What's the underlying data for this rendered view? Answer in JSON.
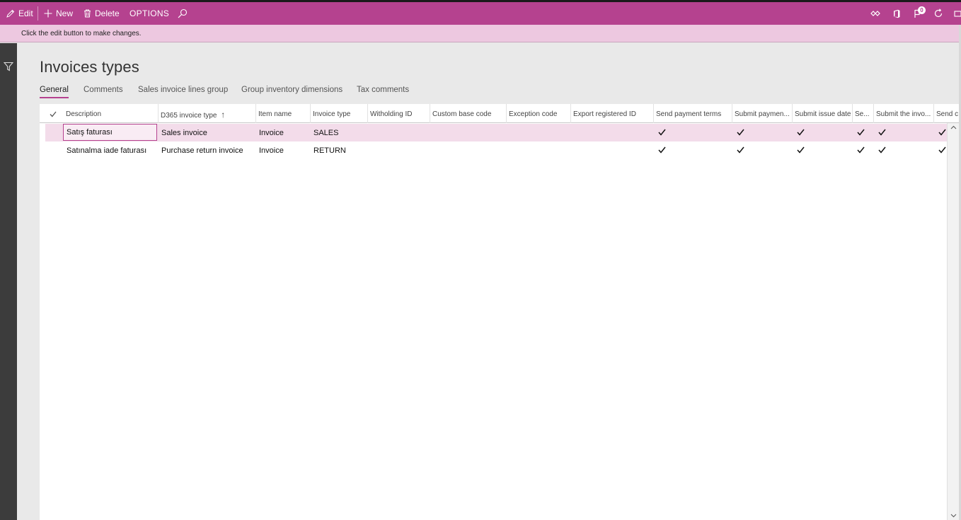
{
  "toolbar": {
    "edit_label": "Edit",
    "new_label": "New",
    "delete_label": "Delete",
    "options_label": "OPTIONS",
    "notification_count": "0"
  },
  "message_bar": {
    "text": "Click the edit button to make changes."
  },
  "page": {
    "title": "Invoices types"
  },
  "tabs": [
    {
      "label": "General",
      "active": true
    },
    {
      "label": "Comments",
      "active": false
    },
    {
      "label": "Sales invoice lines group",
      "active": false
    },
    {
      "label": "Group inventory dimensions",
      "active": false
    },
    {
      "label": "Tax comments",
      "active": false
    }
  ],
  "grid": {
    "columns": [
      "Description",
      "D365 invoice type",
      "Item name",
      "Invoice type",
      "Witholding ID",
      "Custom base code",
      "Exception code",
      "Export registered ID",
      "Send payment terms",
      "Submit paymen...",
      "Submit issue date",
      "Se...",
      "Submit the invo...",
      "Send c"
    ],
    "sorted_column_indicator": "↑",
    "rows": [
      {
        "description": "Satış faturası",
        "d365_invoice_type": "Sales invoice",
        "item_name": "Invoice",
        "invoice_type": "SALES",
        "witholding_id": "",
        "custom_base_code": "",
        "exception_code": "",
        "export_registered_id": "",
        "checks": [
          true,
          true,
          true,
          true,
          true,
          true
        ],
        "selected": true
      },
      {
        "description": "Satınalma iade faturası",
        "d365_invoice_type": "Purchase return invoice",
        "item_name": "Invoice",
        "invoice_type": "RETURN",
        "witholding_id": "",
        "custom_base_code": "",
        "exception_code": "",
        "export_registered_id": "",
        "checks": [
          true,
          true,
          true,
          true,
          true,
          true
        ],
        "selected": false
      }
    ]
  },
  "colors": {
    "accent": "#b5428f",
    "message_bar_bg": "#edc8e0",
    "selected_row_bg": "#f3dcea",
    "nav_bg": "#3c3c3c"
  }
}
